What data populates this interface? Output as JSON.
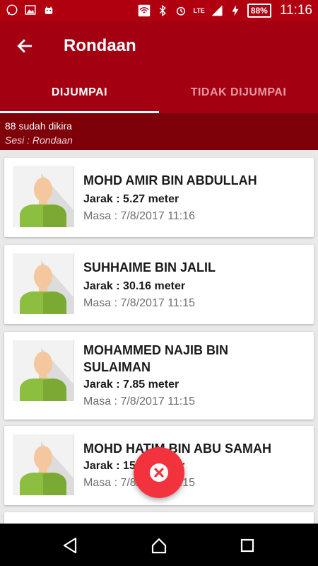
{
  "status_bar": {
    "time": "11:16",
    "battery": "88%",
    "network": "LTE"
  },
  "app_bar": {
    "title": "Rondaan"
  },
  "tabs": [
    {
      "label": "DIJUMPAI",
      "active": true
    },
    {
      "label": "TIDAK DIJUMPAI",
      "active": false
    }
  ],
  "info": {
    "count_text": "88 sudah dikira",
    "session_text": "Sesi : Rondaan"
  },
  "people": [
    {
      "name": "MOHD AMIR BIN ABDULLAH",
      "jarak": "Jarak : 5.27 meter",
      "masa": "Masa : 7/8/2017 11:16"
    },
    {
      "name": "SUHHAIME BIN JALIL",
      "jarak": "Jarak : 30.16 meter",
      "masa": "Masa : 7/8/2017 11:15"
    },
    {
      "name": "MOHAMMED NAJIB BIN SULAIMAN",
      "jarak": "Jarak : 7.85 meter",
      "masa": "Masa : 7/8/2017 11:15"
    },
    {
      "name": "MOHD HATIM BIN ABU SAMAH",
      "jarak": "Jarak : 15.11 meter",
      "masa": "Masa : 7/8/2017 11:15"
    }
  ],
  "colors": {
    "primary": "#a30012",
    "status": "#b00010",
    "infobar": "#7e0008",
    "fab": "#f2333d"
  },
  "icons": {
    "back": "arrow-left-icon",
    "fab": "close-circle-icon",
    "nav": [
      "back-triangle-icon",
      "home-circle-icon",
      "recents-square-icon"
    ]
  }
}
